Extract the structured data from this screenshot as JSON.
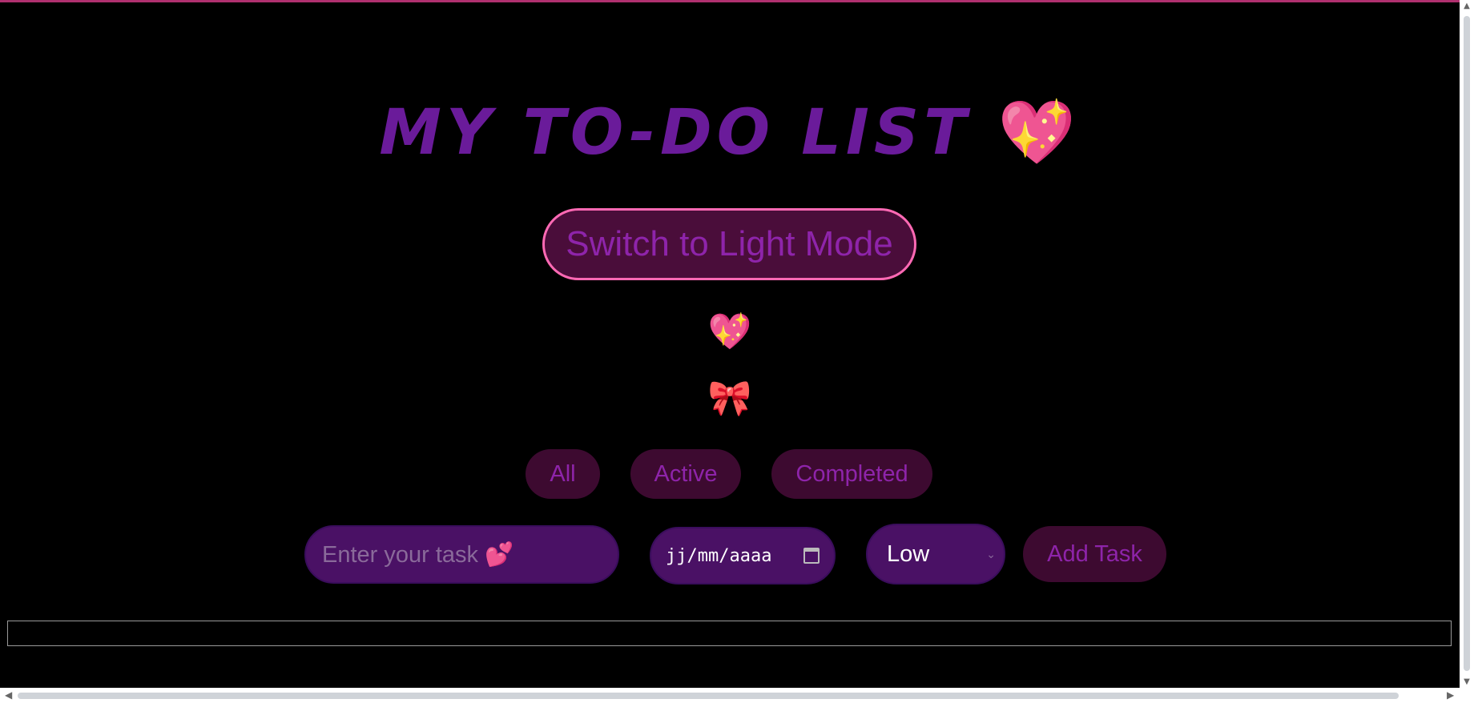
{
  "header": {
    "title": "MY TO-DO LIST",
    "title_emoji": "💖"
  },
  "theme_toggle": {
    "label": "Switch to Light Mode"
  },
  "decorations": {
    "heart": "💖",
    "bow": "🎀"
  },
  "filters": [
    {
      "label": "All"
    },
    {
      "label": "Active"
    },
    {
      "label": "Completed"
    }
  ],
  "task_form": {
    "task_placeholder": "Enter your task 💕",
    "task_value": "",
    "date_placeholder": "jj/mm/aaaa",
    "priority_selected": "Low",
    "add_label": "Add Task"
  },
  "colors": {
    "title": "#6a1b9a",
    "accent_border": "#ff69b4",
    "button_text": "#8e24aa",
    "input_bg": "#4a1165",
    "button_bg": "#3d0a30"
  },
  "icons": {
    "date": "calendar-icon",
    "select": "chevron-down-icon"
  }
}
